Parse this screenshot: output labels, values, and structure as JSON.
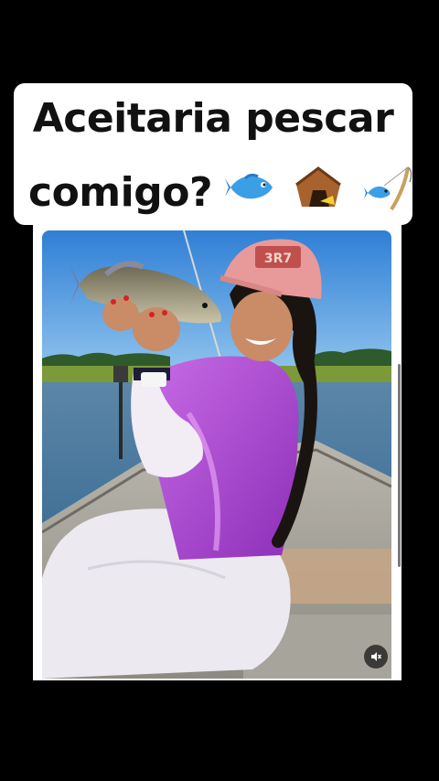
{
  "caption": {
    "line1": "Aceitaria pescar",
    "line2": "comigo?",
    "emojis": [
      "fish-emoji",
      "fish-trap-emoji",
      "fishing-pole-emoji"
    ]
  },
  "photo": {
    "cap_text": "3R7",
    "subject": "woman-holding-fish-on-boat"
  },
  "controls": {
    "mute_icon": "speaker-muted-icon"
  },
  "colors": {
    "background": "#000000",
    "card": "#ffffff",
    "shirt": "#b54fd6",
    "sky": "#3a86d8",
    "water": "#4f7fa6"
  }
}
